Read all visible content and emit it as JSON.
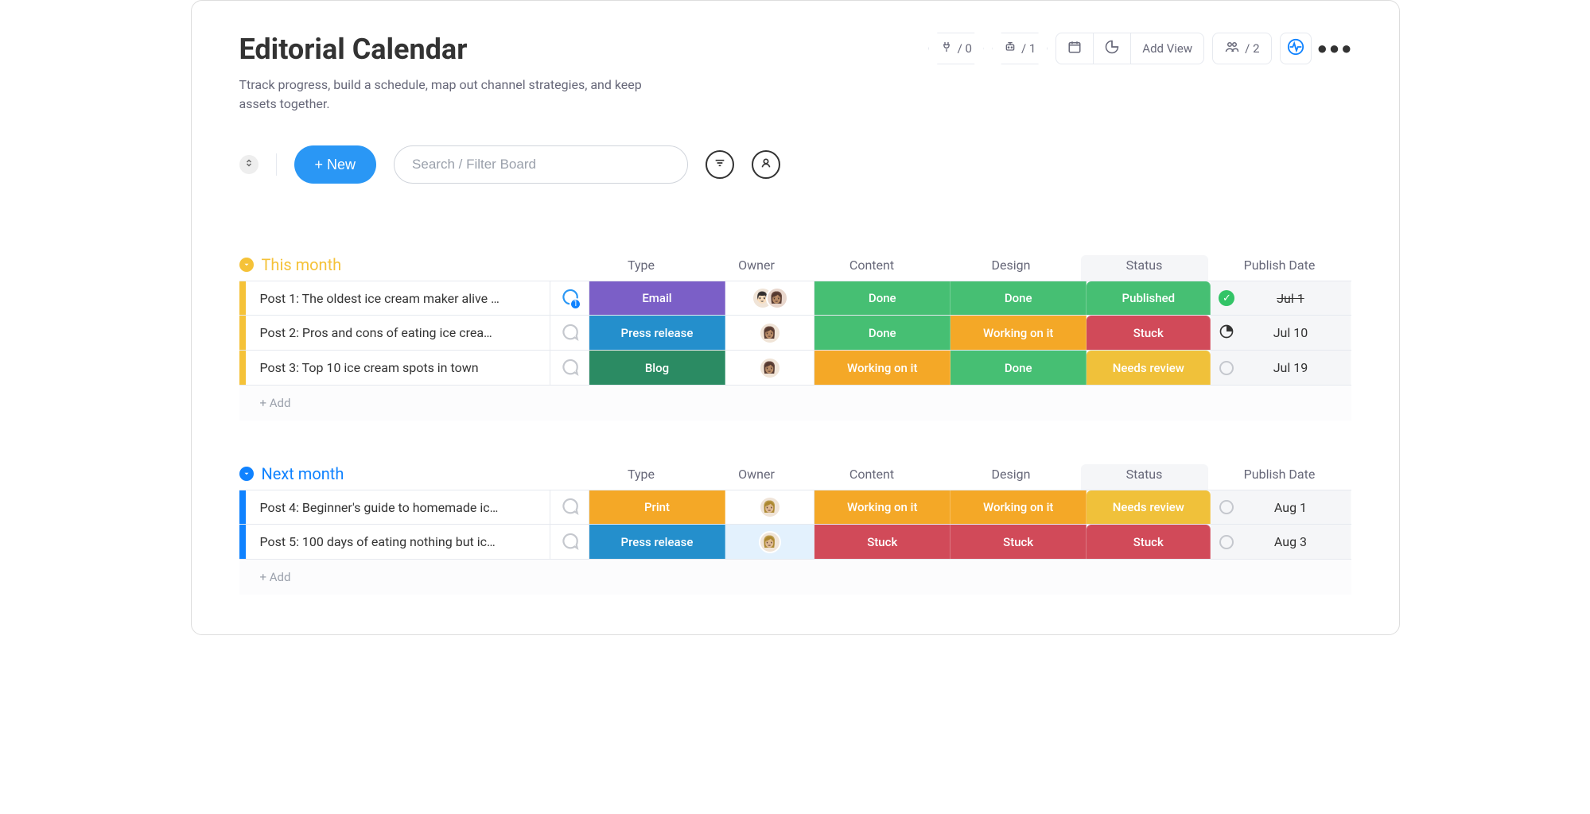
{
  "header": {
    "title": "Editorial Calendar",
    "subtitle": "Ttrack progress, build a schedule, map out channel strategies, and keep assets together.",
    "integrations_count": "/ 0",
    "automations_count": "/ 1",
    "add_view_label": "Add View",
    "members_count": "/ 2"
  },
  "toolbar": {
    "new_label": "+ New",
    "search_placeholder": "Search / Filter Board"
  },
  "columns": {
    "type": "Type",
    "owner": "Owner",
    "content": "Content",
    "design": "Design",
    "status": "Status",
    "date": "Publish Date"
  },
  "add_label": "+ Add",
  "statuses": {
    "done": "Done",
    "working": "Working on it",
    "stuck": "Stuck",
    "published": "Published",
    "needs_review": "Needs review"
  },
  "types": {
    "email": "Email",
    "press_release": "Press release",
    "blog": "Blog",
    "print": "Print"
  },
  "groups": [
    {
      "title": "This month",
      "accent": "yellow",
      "rows": [
        {
          "title": "Post 1: The oldest ice cream maker alive …",
          "chat_count": 1,
          "type": {
            "label_key": "types.email",
            "color": "#7b5fc7"
          },
          "owners": [
            "👨🏻",
            "👩🏽"
          ],
          "owner_bg": "plain",
          "content": {
            "label_key": "statuses.done",
            "color": "#46bf73"
          },
          "design": {
            "label_key": "statuses.done",
            "color": "#46bf73"
          },
          "status": {
            "label_key": "statuses.published",
            "color": "#46bf73"
          },
          "date": {
            "indicator": "check",
            "text": "Jul 1",
            "struck": true
          }
        },
        {
          "title": "Post 2: Pros and cons of eating ice crea…",
          "chat_count": 0,
          "type": {
            "label_key": "types.press_release",
            "color": "#248fcc"
          },
          "owners": [
            "👩🏽"
          ],
          "owner_bg": "plain",
          "content": {
            "label_key": "statuses.done",
            "color": "#46bf73"
          },
          "design": {
            "label_key": "statuses.working",
            "color": "#f4a827"
          },
          "status": {
            "label_key": "statuses.stuck",
            "color": "#d14a59"
          },
          "date": {
            "indicator": "partial",
            "text": "Jul 10",
            "struck": false
          }
        },
        {
          "title": "Post 3: Top 10 ice cream spots in town",
          "chat_count": 0,
          "type": {
            "label_key": "types.blog",
            "color": "#2b8b63"
          },
          "owners": [
            "👩🏽"
          ],
          "owner_bg": "plain",
          "content": {
            "label_key": "statuses.working",
            "color": "#f4a827"
          },
          "design": {
            "label_key": "statuses.done",
            "color": "#46bf73"
          },
          "status": {
            "label_key": "statuses.needs_review",
            "color": "#f0c13a"
          },
          "date": {
            "indicator": "empty",
            "text": "Jul 19",
            "struck": false
          }
        }
      ]
    },
    {
      "title": "Next month",
      "accent": "blue",
      "rows": [
        {
          "title": "Post 4: Beginner's guide to homemade ic…",
          "chat_count": 0,
          "type": {
            "label_key": "types.print",
            "color": "#f4a827"
          },
          "owners": [
            "👩🏼"
          ],
          "owner_bg": "plain",
          "content": {
            "label_key": "statuses.working",
            "color": "#f4a827"
          },
          "design": {
            "label_key": "statuses.working",
            "color": "#f4a827"
          },
          "status": {
            "label_key": "statuses.needs_review",
            "color": "#f0c13a"
          },
          "date": {
            "indicator": "empty",
            "text": "Aug 1",
            "struck": false
          }
        },
        {
          "title": "Post 5: 100 days of eating nothing but ic…",
          "chat_count": 0,
          "type": {
            "label_key": "types.press_release",
            "color": "#248fcc"
          },
          "owners": [
            "👩🏼"
          ],
          "owner_bg": "pale",
          "content": {
            "label_key": "statuses.stuck",
            "color": "#d14a59"
          },
          "design": {
            "label_key": "statuses.stuck",
            "color": "#d14a59"
          },
          "status": {
            "label_key": "statuses.stuck",
            "color": "#d14a59"
          },
          "date": {
            "indicator": "empty",
            "text": "Aug 3",
            "struck": false
          }
        }
      ]
    }
  ]
}
